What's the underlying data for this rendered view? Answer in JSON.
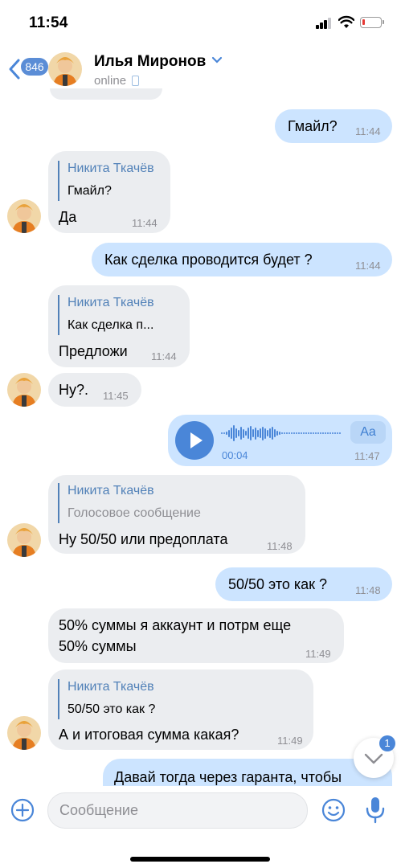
{
  "status_bar": {
    "time": "11:54"
  },
  "header": {
    "back_badge": "846",
    "contact_name": "Илья Миронов",
    "contact_status": "online"
  },
  "messages": {
    "m1": {
      "text": "Гмайл?",
      "time": "11:44"
    },
    "m2": {
      "reply_author": "Никита Ткачёв",
      "reply_text": "Гмайл?",
      "text": "Да",
      "time": "11:44"
    },
    "m3": {
      "text": "Как сделка проводится будет ?",
      "time": "11:44"
    },
    "m4": {
      "reply_author": "Никита Ткачёв",
      "reply_text": "Как сделка п...",
      "text": "Предложи",
      "time": "11:44"
    },
    "m5": {
      "text": "Ну?.",
      "time": "11:45"
    },
    "m6": {
      "duration": "00:04",
      "transcribe_label": "Aa",
      "time": "11:47"
    },
    "m7": {
      "reply_author": "Никита Ткачёв",
      "reply_text": "Голосовое сообщение",
      "text": "Ну 50/50 или предоплата",
      "time": "11:48"
    },
    "m8": {
      "text": "50/50 это как ?",
      "time": "11:48"
    },
    "m9": {
      "line1": "50% суммы я аккаунт и потрм еще",
      "line2": "50% суммы",
      "time": "11:49"
    },
    "m10": {
      "reply_author": "Никита Ткачёв",
      "reply_text": "50/50 это как ?",
      "text": "А и итоговая сумма какая?",
      "time": "11:49"
    },
    "m11": {
      "text": "Давай тогда через гаранта, чтобы"
    }
  },
  "scroll_button": {
    "count": "1"
  },
  "composer": {
    "placeholder": "Сообщение"
  },
  "colors": {
    "accent": "#4a86d8",
    "incoming": "#ebedf0",
    "outgoing": "#cce4ff"
  }
}
